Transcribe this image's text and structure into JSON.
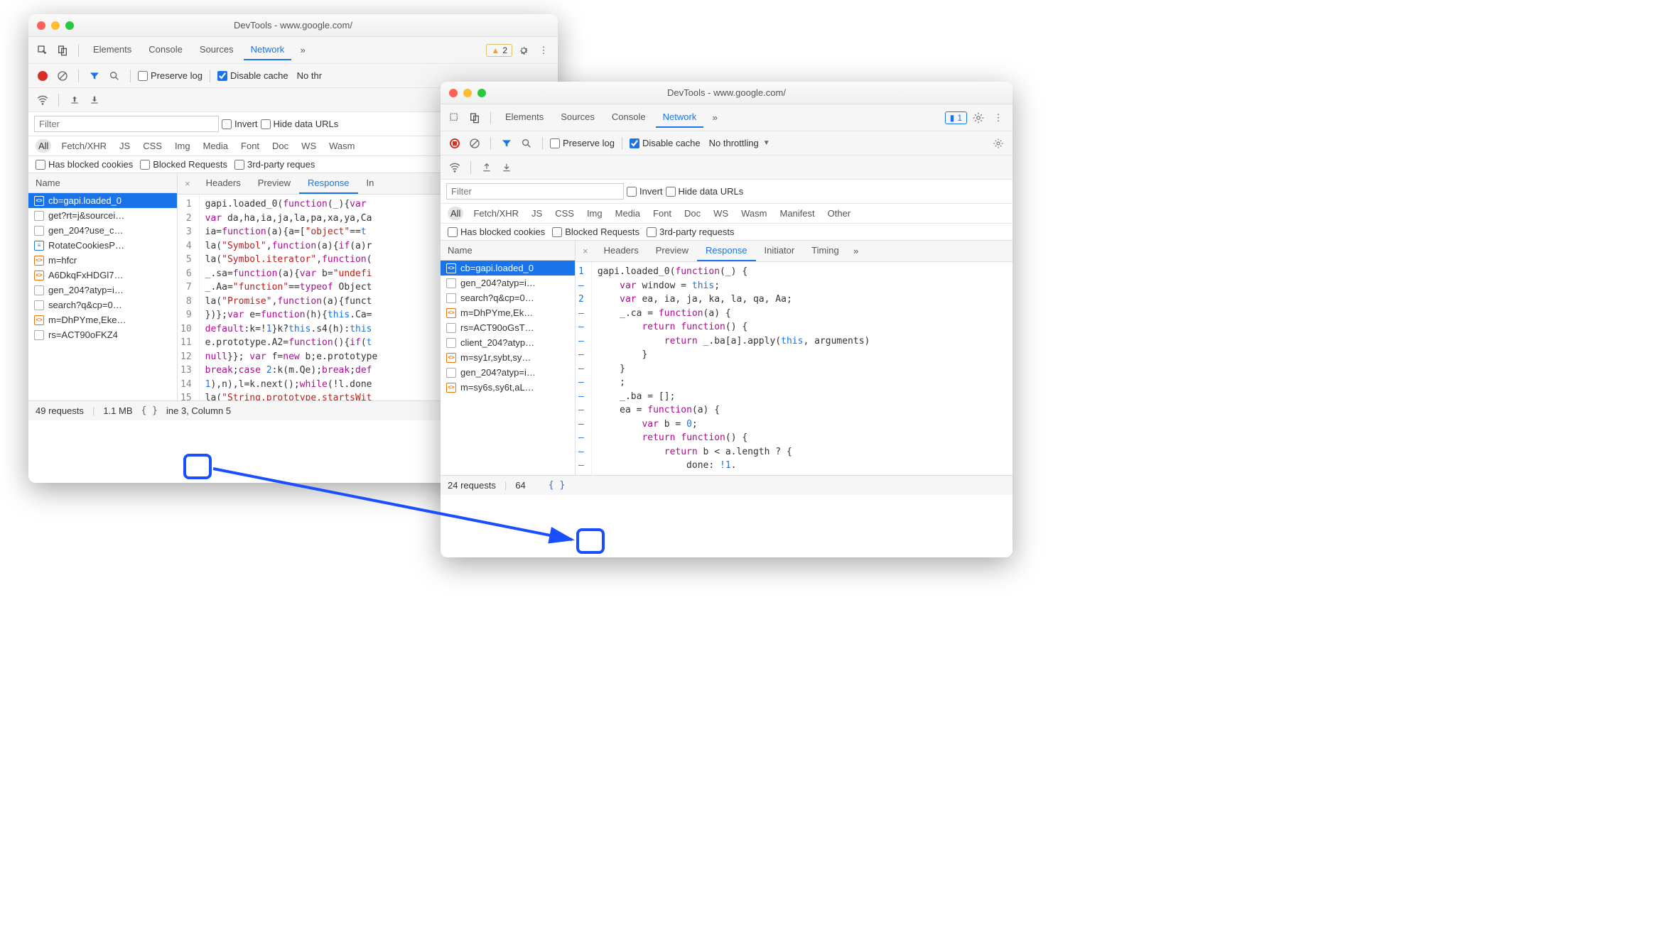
{
  "window1": {
    "title": "DevTools - www.google.com/",
    "tabs": [
      "Elements",
      "Console",
      "Sources",
      "Network"
    ],
    "active_tab": "Network",
    "warning_count": "2",
    "toolbar": {
      "preserve_log": "Preserve log",
      "disable_cache": "Disable cache",
      "throttling": "No thr"
    },
    "filter_placeholder": "Filter",
    "filter_options": {
      "invert": "Invert",
      "hide_data_urls": "Hide data URLs"
    },
    "type_filters": [
      "All",
      "Fetch/XHR",
      "JS",
      "CSS",
      "Img",
      "Media",
      "Font",
      "Doc",
      "WS",
      "Wasm"
    ],
    "extra_checks": {
      "blocked_cookies": "Has blocked cookies",
      "blocked_requests": "Blocked Requests",
      "third_party": "3rd-party reques"
    },
    "name_col": "Name",
    "requests": [
      {
        "icon": "orange",
        "label": "cb=gapi.loaded_0",
        "selected": true
      },
      {
        "icon": "grey",
        "label": "get?rt=j&sourcei…"
      },
      {
        "icon": "grey",
        "label": "gen_204?use_c…"
      },
      {
        "icon": "blue",
        "label": "RotateCookiesP…"
      },
      {
        "icon": "orange",
        "label": "m=hfcr"
      },
      {
        "icon": "orange",
        "label": "A6DkqFxHDGl7…"
      },
      {
        "icon": "grey",
        "label": "gen_204?atyp=i…"
      },
      {
        "icon": "grey",
        "label": "search?q&cp=0…"
      },
      {
        "icon": "orange",
        "label": "m=DhPYme,Eke…"
      },
      {
        "icon": "grey",
        "label": "rs=ACT90oFKZ4"
      }
    ],
    "detail_tabs": [
      "Headers",
      "Preview",
      "Response",
      "In"
    ],
    "active_detail_tab": "Response",
    "code_lines": [
      {
        "n": "1",
        "html": "gapi.loaded_0(<span class='tok-kw'>function</span>(_){<span class='tok-kw'>var</span>"
      },
      {
        "n": "2",
        "html": "<span class='tok-kw'>var</span> da,ha,ia,ja,la,pa,xa,ya,Ca"
      },
      {
        "n": "3",
        "html": "ia=<span class='tok-kw'>function</span>(a){a=[<span class='tok-str'>\"object\"</span>==<span class='tok-var'>t</span>"
      },
      {
        "n": "4",
        "html": "la(<span class='tok-str'>\"Symbol\"</span>,<span class='tok-kw'>function</span>(a){<span class='tok-kw'>if</span>(a)r"
      },
      {
        "n": "5",
        "html": "la(<span class='tok-str'>\"Symbol.iterator\"</span>,<span class='tok-kw'>function</span>("
      },
      {
        "n": "6",
        "html": "_.sa=<span class='tok-kw'>function</span>(a){<span class='tok-kw'>var</span> b=<span class='tok-str'>\"undefi</span>"
      },
      {
        "n": "7",
        "html": "_.Aa=<span class='tok-str'>\"function\"</span>==<span class='tok-kw'>typeof</span> Object"
      },
      {
        "n": "8",
        "html": "la(<span class='tok-str'>\"Promise\"</span>,<span class='tok-kw'>function</span>(a){funct"
      },
      {
        "n": "9",
        "html": "})};<span class='tok-kw'>var</span> e=<span class='tok-kw'>function</span>(h){<span class='tok-this'>this</span>.Ca="
      },
      {
        "n": "10",
        "html": "<span class='tok-kw'>default</span>:k=!<span class='tok-var'>1</span>}k?<span class='tok-this'>this</span>.s4(h):<span class='tok-this'>this</span>"
      },
      {
        "n": "11",
        "html": "e.prototype.A2=<span class='tok-kw'>function</span>(){<span class='tok-kw'>if</span>(<span class='tok-var'>t</span>"
      },
      {
        "n": "12",
        "html": "<span class='tok-kw'>null</span>}}; <span class='tok-kw'>var</span> f=<span class='tok-kw'>new</span> b;e.prototype"
      },
      {
        "n": "13",
        "html": "<span class='tok-kw'>break</span>;<span class='tok-kw'>case</span> <span class='tok-var'>2</span>:k(m.Qe);<span class='tok-kw'>break</span>;<span class='tok-kw'>def</span>"
      },
      {
        "n": "14",
        "html": "<span class='tok-var'>1</span>),n),l=k.next();<span class='tok-kw'>while</span>(!l.done"
      },
      {
        "n": "15",
        "html": "la(<span class='tok-str'>\"String.prototype.startsWit</span>"
      }
    ],
    "status": {
      "requests": "49 requests",
      "size": "1.1 MB",
      "cursor": "ine 3, Column 5"
    }
  },
  "window2": {
    "title": "DevTools - www.google.com/",
    "tabs": [
      "Elements",
      "Sources",
      "Console",
      "Network"
    ],
    "active_tab": "Network",
    "message_count": "1",
    "toolbar": {
      "preserve_log": "Preserve log",
      "disable_cache": "Disable cache",
      "throttling": "No throttling"
    },
    "filter_placeholder": "Filter",
    "filter_options": {
      "invert": "Invert",
      "hide_data_urls": "Hide data URLs"
    },
    "type_filters": [
      "All",
      "Fetch/XHR",
      "JS",
      "CSS",
      "Img",
      "Media",
      "Font",
      "Doc",
      "WS",
      "Wasm",
      "Manifest",
      "Other"
    ],
    "extra_checks": {
      "blocked_cookies": "Has blocked cookies",
      "blocked_requests": "Blocked Requests",
      "third_party": "3rd-party requests"
    },
    "name_col": "Name",
    "requests": [
      {
        "icon": "orange",
        "label": "cb=gapi.loaded_0",
        "selected": true
      },
      {
        "icon": "grey",
        "label": "gen_204?atyp=i…"
      },
      {
        "icon": "grey",
        "label": "search?q&cp=0…"
      },
      {
        "icon": "orange",
        "label": "m=DhPYme,Ek…"
      },
      {
        "icon": "grey",
        "label": "rs=ACT90oGsT…"
      },
      {
        "icon": "grey",
        "label": "client_204?atyp…"
      },
      {
        "icon": "orange",
        "label": "m=sy1r,sybt,sy…"
      },
      {
        "icon": "grey",
        "label": "gen_204?atyp=i…"
      },
      {
        "icon": "orange",
        "label": "m=sy6s,sy6t,aL…"
      }
    ],
    "detail_tabs": [
      "Headers",
      "Preview",
      "Response",
      "Initiator",
      "Timing"
    ],
    "active_detail_tab": "Response",
    "code_lines": [
      {
        "n": "1",
        "html": "gapi.loaded_0(<span class='tok-kw'>function</span>(_) {"
      },
      {
        "n": "–",
        "html": "    <span class='tok-kw'>var</span> window = <span class='tok-this'>this</span>;"
      },
      {
        "n": "2",
        "html": "    <span class='tok-kw'>var</span> ea, ia, ja, ka, la, qa, Aa;"
      },
      {
        "n": "–",
        "html": "    _.ca = <span class='tok-kw'>function</span>(a) {"
      },
      {
        "n": "–",
        "html": "        <span class='tok-kw'>return</span> <span class='tok-kw'>function</span>() {"
      },
      {
        "n": "–",
        "html": "            <span class='tok-kw'>return</span> _.ba[a].apply(<span class='tok-this'>this</span>, arguments)"
      },
      {
        "n": "–",
        "html": "        }"
      },
      {
        "n": "–",
        "html": "    }"
      },
      {
        "n": "–",
        "html": "    ;"
      },
      {
        "n": "–",
        "html": "    _.ba = [];"
      },
      {
        "n": "–",
        "html": "    ea = <span class='tok-kw'>function</span>(a) {"
      },
      {
        "n": "–",
        "html": "        <span class='tok-kw'>var</span> b = <span class='tok-var'>0</span>;"
      },
      {
        "n": "–",
        "html": "        <span class='tok-kw'>return</span> <span class='tok-kw'>function</span>() {"
      },
      {
        "n": "–",
        "html": "            <span class='tok-kw'>return</span> b < a.length ? {"
      },
      {
        "n": "–",
        "html": "                done: <span class='tok-var'>!1</span>."
      }
    ],
    "status": {
      "requests": "24 requests",
      "size": "64"
    }
  }
}
